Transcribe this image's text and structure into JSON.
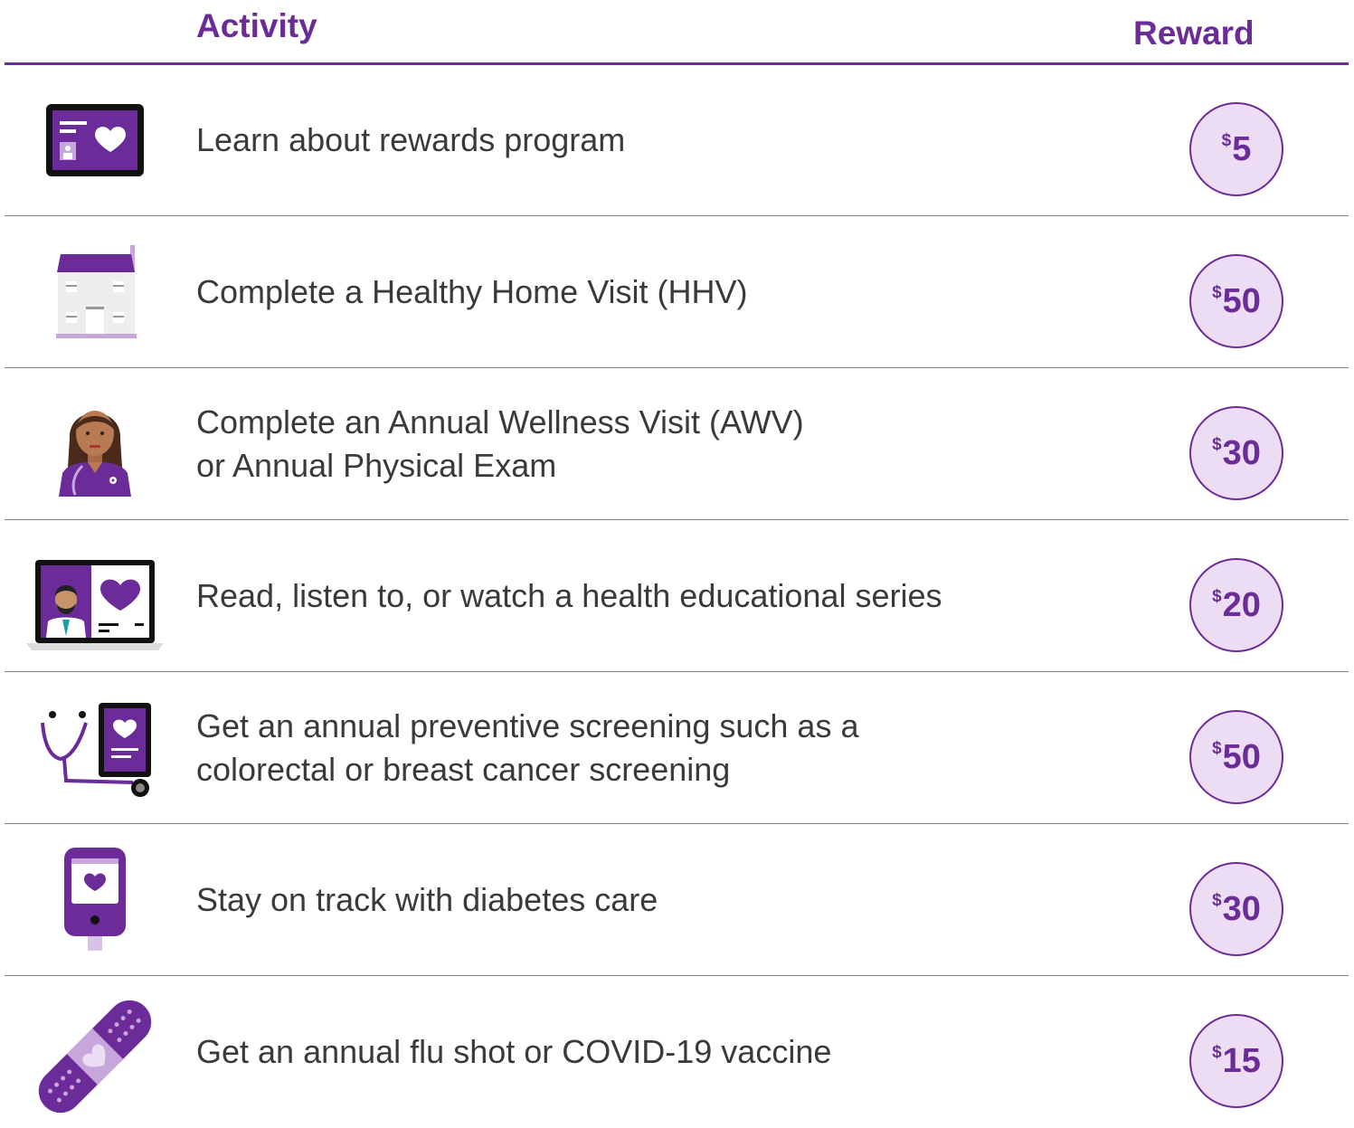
{
  "header": {
    "activity_label": "Activity",
    "reward_label": "Reward"
  },
  "colors": {
    "accent": "#6b2c9a",
    "badge_fill": "#ecdcf4",
    "divider": "#7d7d7d"
  },
  "rows": [
    {
      "icon": "tablet-heart-icon",
      "lines": [
        "Learn about rewards program"
      ],
      "reward": {
        "currency": "$",
        "amount": "5"
      }
    },
    {
      "icon": "house-icon",
      "lines": [
        "Complete a Healthy Home Visit (HHV)"
      ],
      "reward": {
        "currency": "$",
        "amount": "50"
      }
    },
    {
      "icon": "doctor-icon",
      "lines": [
        "Complete an Annual Wellness Visit (AWV)",
        "or Annual Physical Exam"
      ],
      "reward": {
        "currency": "$",
        "amount": "30"
      }
    },
    {
      "icon": "laptop-telehealth-icon",
      "lines": [
        "Read, listen to, or watch a health educational series"
      ],
      "reward": {
        "currency": "$",
        "amount": "20"
      }
    },
    {
      "icon": "stethoscope-tablet-icon",
      "lines": [
        "Get an annual preventive screening such as a",
        "colorectal or breast cancer screening"
      ],
      "reward": {
        "currency": "$",
        "amount": "50"
      }
    },
    {
      "icon": "glucose-meter-icon",
      "lines": [
        "Stay on track with diabetes care"
      ],
      "reward": {
        "currency": "$",
        "amount": "30"
      }
    },
    {
      "icon": "bandage-icon",
      "lines": [
        "Get an annual flu shot or COVID-19 vaccine"
      ],
      "reward": {
        "currency": "$",
        "amount": "15"
      }
    }
  ]
}
